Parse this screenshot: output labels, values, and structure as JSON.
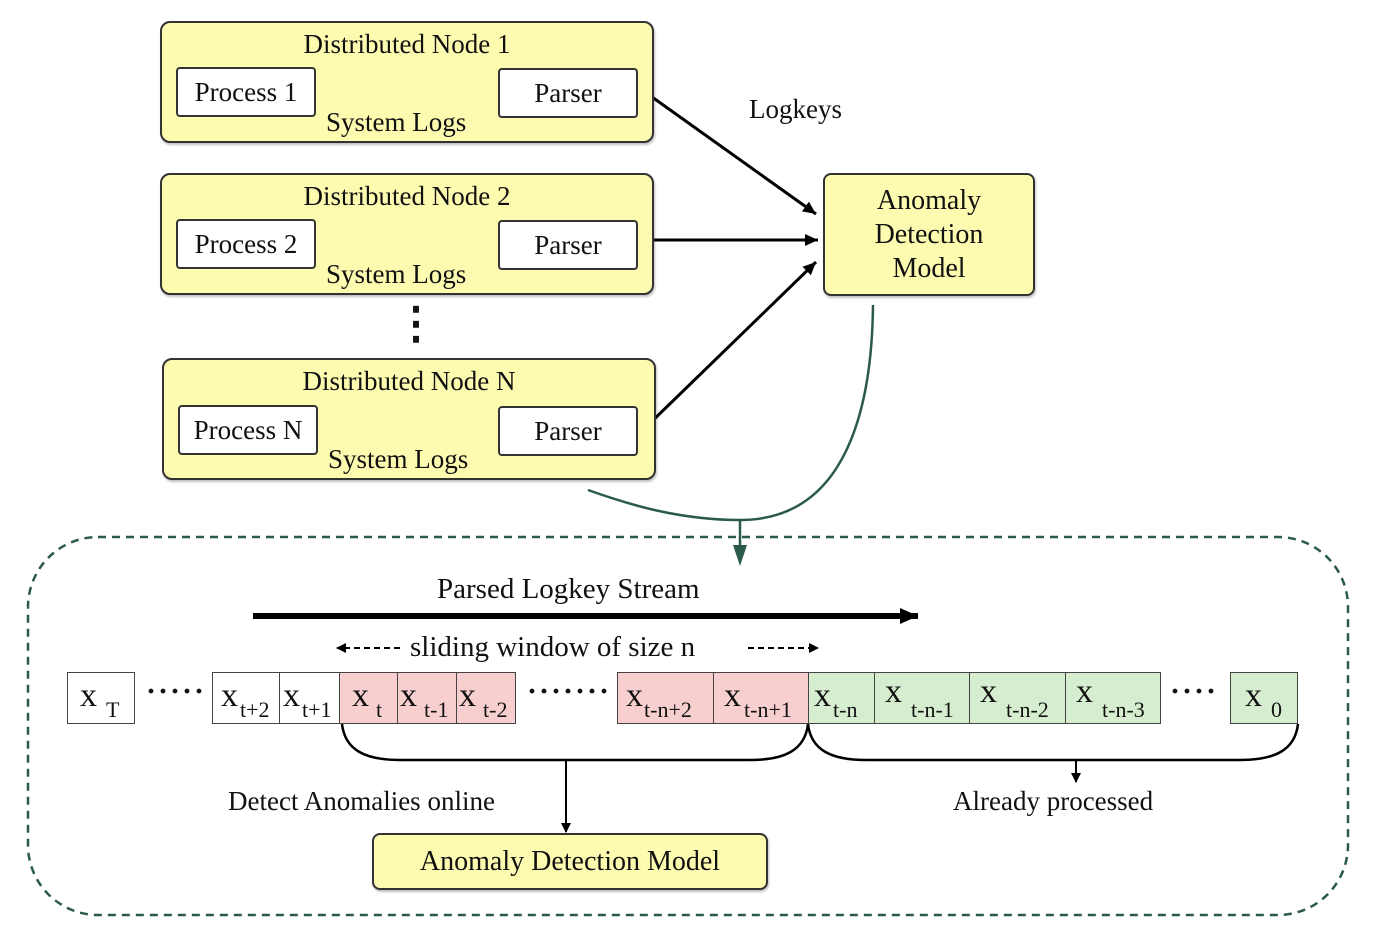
{
  "colors": {
    "node_fill": "#fdfbb0",
    "window_fill": "#f7cfcf",
    "processed_fill": "#d6edcf",
    "flow_arrow": "#2a5a48",
    "dashed_border": "#2a5a48"
  },
  "nodes": [
    {
      "title": "Distributed Node 1",
      "process": "Process 1",
      "parser": "Parser",
      "edge_label": "System Logs"
    },
    {
      "title": "Distributed Node 2",
      "process": "Process 2",
      "parser": "Parser",
      "edge_label": "System Logs"
    },
    {
      "title": "Distributed Node N",
      "process": "Process N",
      "parser": "Parser",
      "edge_label": "System Logs"
    }
  ],
  "vertical_ellipsis": "⋮",
  "logkeys_label": "Logkeys",
  "top_model": {
    "line1": "Anomaly",
    "line2": "Detection",
    "line3": "Model"
  },
  "stream": {
    "title": "Parsed Logkey Stream",
    "window_label": "sliding window of size n",
    "cells": [
      {
        "base": "x",
        "sub": "T",
        "state": "unprocessed"
      },
      {
        "base": "x",
        "sub": "t+2",
        "state": "unprocessed"
      },
      {
        "base": "x",
        "sub": "t+1",
        "state": "unprocessed"
      },
      {
        "base": "x",
        "sub": "t",
        "state": "window"
      },
      {
        "base": "x",
        "sub": "t-1",
        "state": "window"
      },
      {
        "base": "x",
        "sub": "t-2",
        "state": "window"
      },
      {
        "base": "x",
        "sub": "t-n+2",
        "state": "window"
      },
      {
        "base": "x",
        "sub": "t-n+1",
        "state": "window"
      },
      {
        "base": "x",
        "sub": "t-n",
        "state": "processed"
      },
      {
        "base": "x",
        "sub": "t-n-1",
        "state": "processed"
      },
      {
        "base": "x",
        "sub": "t-n-2",
        "state": "processed"
      },
      {
        "base": "x",
        "sub": "t-n-3",
        "state": "processed"
      },
      {
        "base": "x",
        "sub": "0",
        "state": "processed"
      }
    ],
    "ellipsis_short": "·····",
    "ellipsis_long": "·······",
    "ellipsis_end": "····",
    "detect_label": "Detect Anomalies online",
    "processed_label": "Already processed",
    "bottom_model": "Anomaly Detection Model"
  }
}
